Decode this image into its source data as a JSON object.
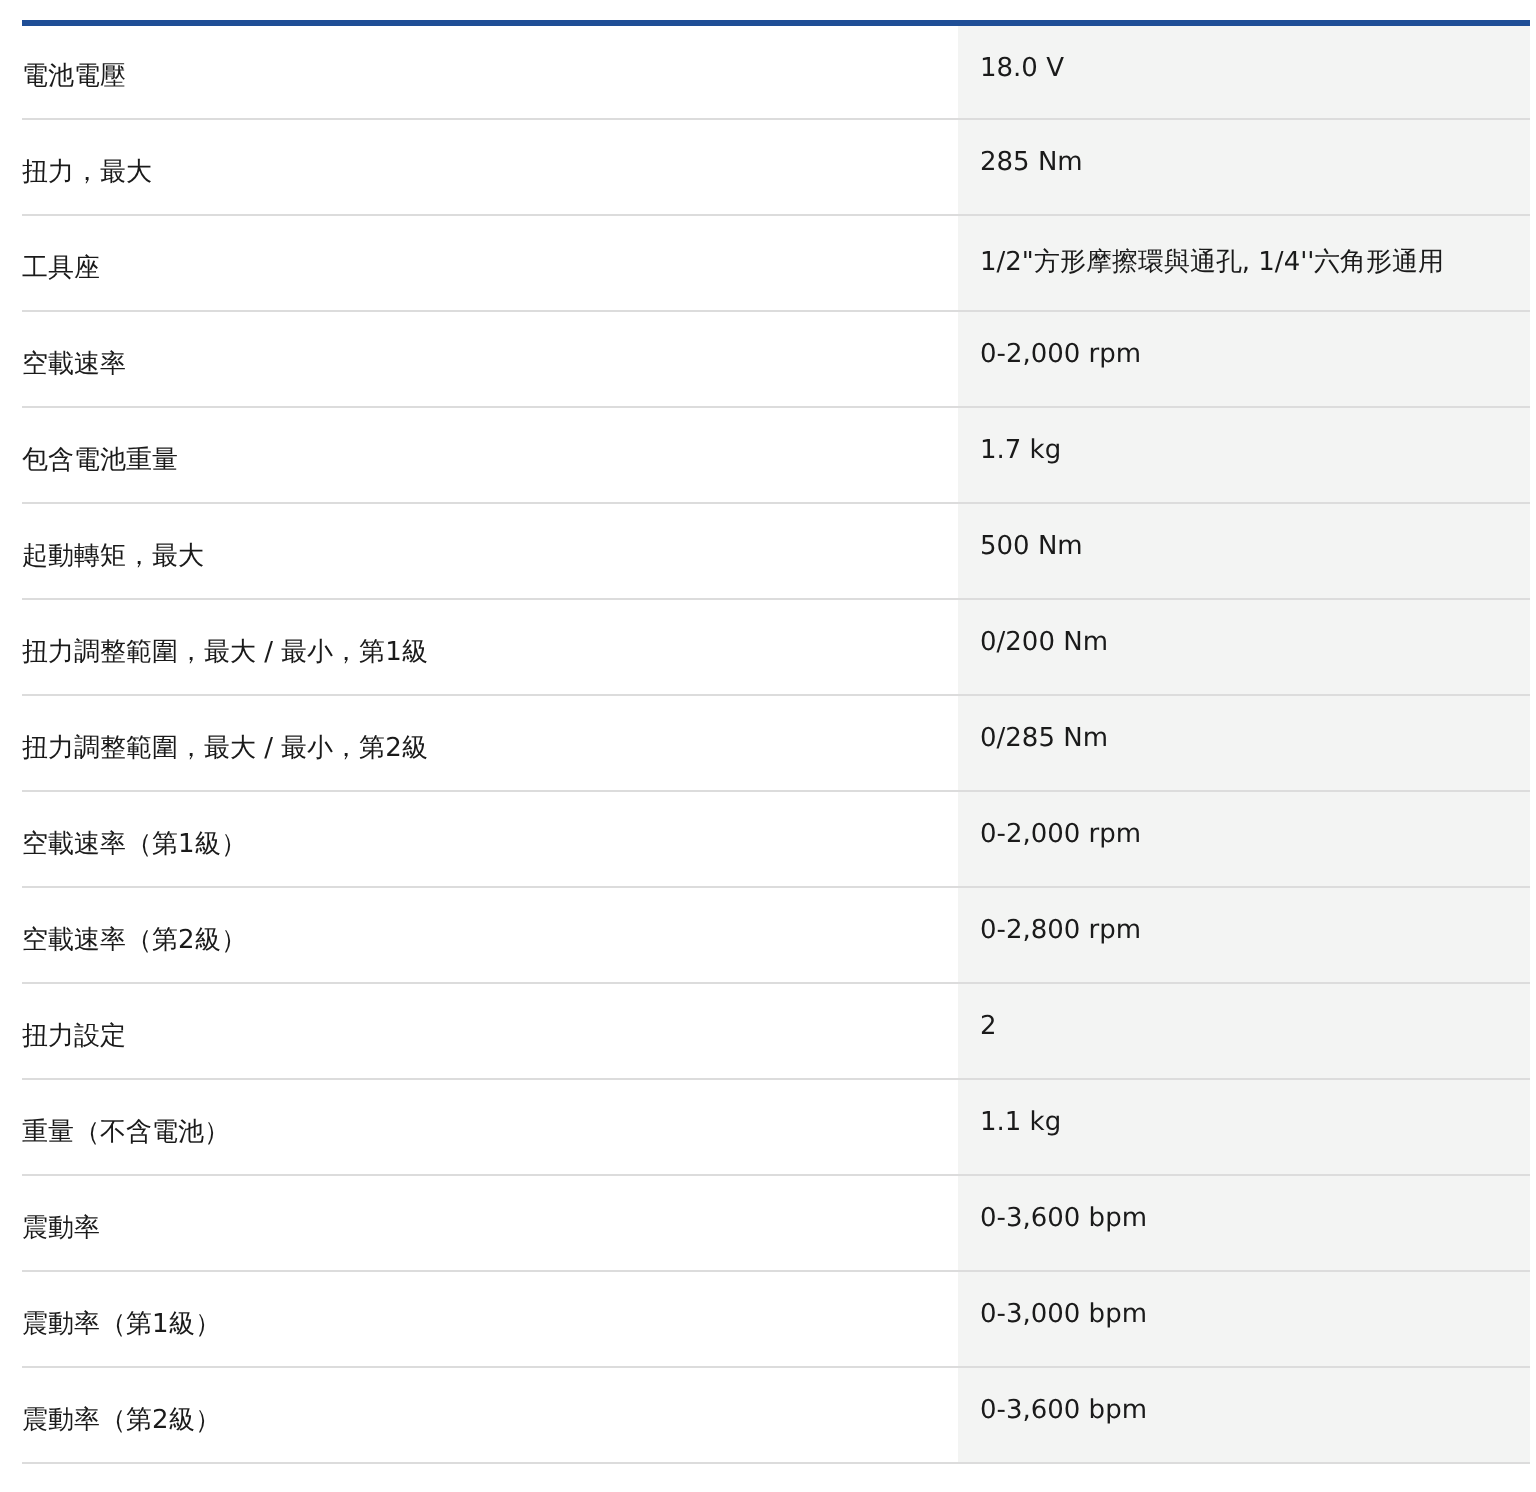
{
  "specs": [
    {
      "label": "電池電壓",
      "value": "18.0 V"
    },
    {
      "label": "扭力，最大",
      "value": "285 Nm"
    },
    {
      "label": "工具座",
      "value": "1/2\"方形摩擦環與通孔, 1/4''六角形通用"
    },
    {
      "label": "空載速率",
      "value": "0-2,000 rpm"
    },
    {
      "label": "包含電池重量",
      "value": "1.7 kg"
    },
    {
      "label": "起動轉矩，最大",
      "value": "500 Nm"
    },
    {
      "label": "扭力調整範圍，最大 / 最小，第1級",
      "value": "0/200 Nm"
    },
    {
      "label": "扭力調整範圍，最大 / 最小，第2級",
      "value": "0/285 Nm"
    },
    {
      "label": "空載速率（第1級）",
      "value": "0-2,000 rpm"
    },
    {
      "label": "空載速率（第2級）",
      "value": "0-2,800 rpm"
    },
    {
      "label": "扭力設定",
      "value": "2"
    },
    {
      "label": "重量（不含電池）",
      "value": "1.1 kg"
    },
    {
      "label": "震動率",
      "value": "0-3,600 bpm"
    },
    {
      "label": "震動率（第1級）",
      "value": "0-3,000 bpm"
    },
    {
      "label": "震動率（第2級）",
      "value": "0-3,600 bpm"
    }
  ]
}
